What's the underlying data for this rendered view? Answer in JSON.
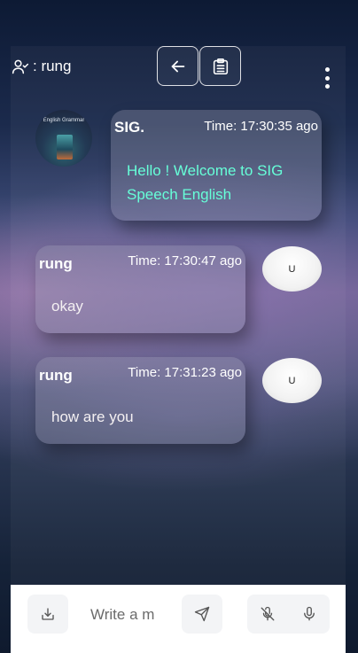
{
  "header": {
    "user_label": ": rung",
    "back_icon": "arrow-left-icon",
    "clipboard_icon": "clipboard-icon",
    "more_icon": "more-vertical-icon"
  },
  "messages": [
    {
      "sender": "SIG.",
      "time": "Time: 17:30:35 ago",
      "text": "Hello ! Welcome to SIG Speech English",
      "avatar_caption": "English Grammar",
      "text_color": "#66ffd8"
    },
    {
      "sender": "rung",
      "time": "Time: 17:30:47 ago",
      "text": "okay",
      "avatar_initial": "U",
      "text_color": "#f4f0f2"
    },
    {
      "sender": "rung",
      "time": "Time: 17:31:23 ago",
      "text": "how are you",
      "avatar_initial": "U",
      "text_color": "#f4f0f2"
    }
  ],
  "composer": {
    "placeholder": "Write a m",
    "upload_icon": "upload-icon",
    "send_icon": "send-icon",
    "mic_off_icon": "mic-off-icon",
    "mic_icon": "mic-icon"
  }
}
